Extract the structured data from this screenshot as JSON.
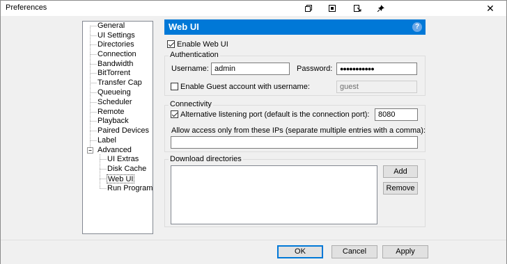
{
  "window": {
    "title": "Preferences"
  },
  "titlebar_icons": [
    "restore-icon",
    "maximize-icon",
    "pin-window-icon",
    "pin-icon"
  ],
  "tree": {
    "items": [
      {
        "label": "General"
      },
      {
        "label": "UI Settings"
      },
      {
        "label": "Directories"
      },
      {
        "label": "Connection"
      },
      {
        "label": "Bandwidth"
      },
      {
        "label": "BitTorrent"
      },
      {
        "label": "Transfer Cap"
      },
      {
        "label": "Queueing"
      },
      {
        "label": "Scheduler"
      },
      {
        "label": "Remote"
      },
      {
        "label": "Playback"
      },
      {
        "label": "Paired Devices"
      },
      {
        "label": "Label"
      },
      {
        "label": "Advanced",
        "expanded": true,
        "expander": "−"
      },
      {
        "label": "UI Extras"
      },
      {
        "label": "Disk Cache"
      },
      {
        "label": "Web UI",
        "selected": true
      },
      {
        "label": "Run Program"
      }
    ]
  },
  "header": {
    "title": "Web UI",
    "help": "?"
  },
  "enable_web_ui": {
    "label": "Enable Web UI",
    "checked": true
  },
  "authentication": {
    "group_label": "Authentication",
    "username_label": "Username:",
    "username_value": "admin",
    "password_label": "Password:",
    "password_value": "●●●●●●●●●●●",
    "guest_label": "Enable Guest account with username:",
    "guest_checked": false,
    "guest_value": "guest"
  },
  "connectivity": {
    "group_label": "Connectivity",
    "alt_port_label": "Alternative listening port (default is the connection port):",
    "alt_port_checked": true,
    "alt_port_value": "8080",
    "allow_ips_label": "Allow access only from these IPs (separate multiple entries with a comma):",
    "allow_ips_value": ""
  },
  "download_dirs": {
    "group_label": "Download directories",
    "add_label": "Add",
    "remove_label": "Remove"
  },
  "footer": {
    "ok_label": "OK",
    "cancel_label": "Cancel",
    "apply_label": "Apply"
  },
  "colors": {
    "accent": "#0078d7",
    "window_bg": "#f0f0f0"
  }
}
